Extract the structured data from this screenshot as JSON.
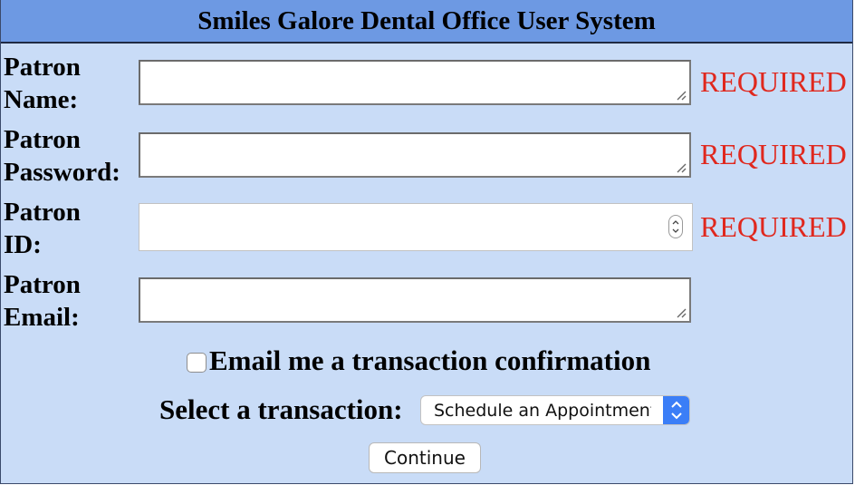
{
  "header": {
    "title": "Smiles Galore Dental Office User System"
  },
  "form": {
    "fields": [
      {
        "label_line1": "Patron",
        "label_line2": "Name:",
        "value": "",
        "required_text": "REQUIRED",
        "type": "textarea"
      },
      {
        "label_line1": "Patron",
        "label_line2": "Password:",
        "value": "",
        "required_text": "REQUIRED",
        "type": "textarea"
      },
      {
        "label_line1": "Patron",
        "label_line2": "ID:",
        "value": "",
        "required_text": "REQUIRED",
        "type": "number"
      },
      {
        "label_line1": "Patron",
        "label_line2": "Email:",
        "value": "",
        "required_text": "",
        "type": "textarea"
      }
    ],
    "email_confirmation": {
      "label": "Email me a transaction confirmation",
      "checked": false
    },
    "transaction": {
      "label": "Select a transaction:",
      "selected": "Schedule an Appointment"
    },
    "continue_label": "Continue"
  },
  "colors": {
    "header_bg": "#6d99e3",
    "panel_bg": "#c9dcf7",
    "required": "#e0281e",
    "select_accent": "#3b7ef7"
  },
  "icons": {
    "resize": "resize-grip-icon",
    "spinner": "number-spinner-icon",
    "select": "chevron-up-down-icon"
  }
}
